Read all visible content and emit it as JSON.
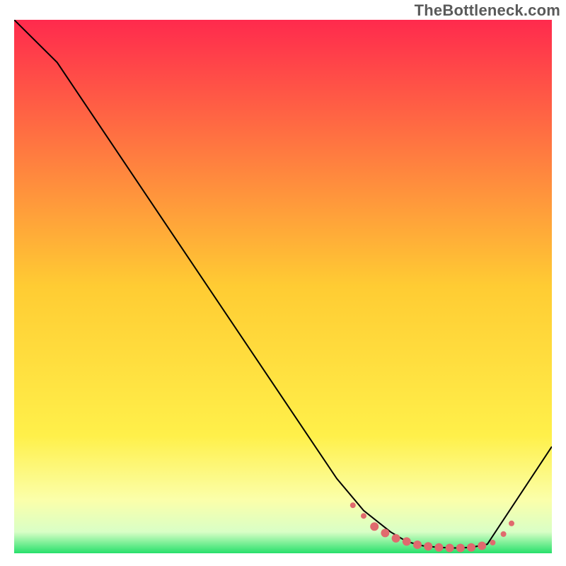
{
  "watermark": "TheBottleneck.com",
  "chart_data": {
    "type": "line",
    "title": "",
    "xlabel": "",
    "ylabel": "",
    "xlim": [
      0,
      100
    ],
    "ylim": [
      0,
      100
    ],
    "grid": false,
    "legend": false,
    "background_gradient": {
      "stops": [
        {
          "offset": 0.0,
          "color": "#ff2a4d"
        },
        {
          "offset": 0.5,
          "color": "#ffcc33"
        },
        {
          "offset": 0.78,
          "color": "#fff04a"
        },
        {
          "offset": 0.9,
          "color": "#fbffaa"
        },
        {
          "offset": 0.96,
          "color": "#d9ffc6"
        },
        {
          "offset": 1.0,
          "color": "#27e06b"
        }
      ]
    },
    "line": {
      "color": "#000000",
      "width": 2,
      "x": [
        0,
        8,
        60,
        65,
        70,
        73,
        76,
        79,
        82,
        85,
        88,
        100
      ],
      "y": [
        100,
        92,
        14,
        8,
        4,
        2.2,
        1.4,
        1.1,
        1.0,
        1.1,
        1.7,
        20
      ]
    },
    "flat_markers": {
      "color": "#e06a6e",
      "radius_small": 4,
      "radius_large": 6,
      "points": [
        {
          "x": 63,
          "y": 9.0,
          "r": 4
        },
        {
          "x": 65,
          "y": 7.0,
          "r": 4
        },
        {
          "x": 67,
          "y": 5.0,
          "r": 6
        },
        {
          "x": 69,
          "y": 3.8,
          "r": 6
        },
        {
          "x": 71,
          "y": 2.8,
          "r": 6
        },
        {
          "x": 73,
          "y": 2.2,
          "r": 6
        },
        {
          "x": 75,
          "y": 1.6,
          "r": 6
        },
        {
          "x": 77,
          "y": 1.3,
          "r": 6
        },
        {
          "x": 79,
          "y": 1.1,
          "r": 6
        },
        {
          "x": 81,
          "y": 1.0,
          "r": 6
        },
        {
          "x": 83,
          "y": 1.0,
          "r": 6
        },
        {
          "x": 85,
          "y": 1.1,
          "r": 6
        },
        {
          "x": 87,
          "y": 1.4,
          "r": 6
        },
        {
          "x": 89,
          "y": 2.0,
          "r": 4
        },
        {
          "x": 91,
          "y": 3.6,
          "r": 4
        },
        {
          "x": 92.5,
          "y": 5.6,
          "r": 4
        }
      ]
    }
  }
}
